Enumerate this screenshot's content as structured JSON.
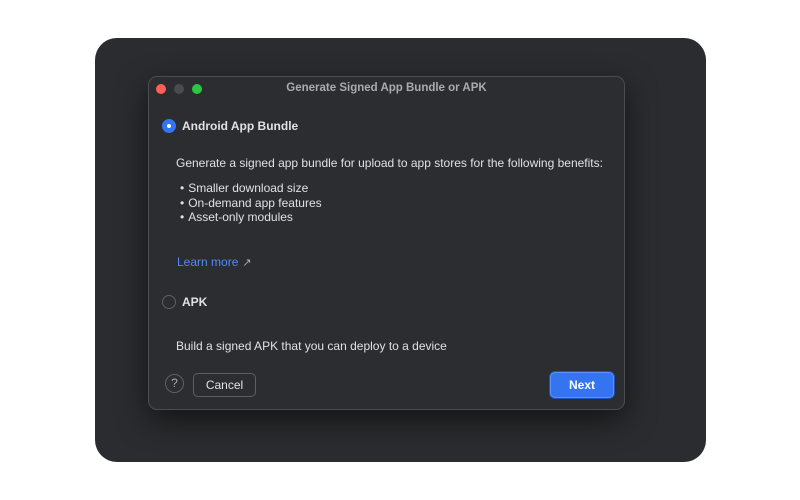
{
  "dialog": {
    "title": "Generate Signed App Bundle or APK"
  },
  "options": {
    "bundle": {
      "label": "Android App Bundle",
      "selected": true,
      "description": "Generate a signed app bundle for upload to app stores for the following benefits:",
      "benefits": [
        "Smaller download size",
        "On-demand app features",
        "Asset-only modules"
      ],
      "learn_more": "Learn more",
      "learn_more_icon": "external-link-arrow-icon"
    },
    "apk": {
      "label": "APK",
      "selected": false,
      "description": "Build a signed APK that you can deploy to a device"
    }
  },
  "footer": {
    "help_label": "?",
    "cancel_label": "Cancel",
    "next_label": "Next"
  },
  "colors": {
    "accent": "#3574f0",
    "link": "#548af7",
    "dialog_background": "#2b2d30"
  }
}
